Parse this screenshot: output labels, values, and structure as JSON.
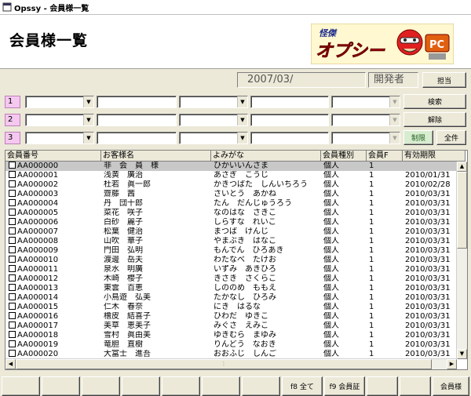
{
  "window": {
    "title": "Opssy - 会員様一覧"
  },
  "header": {
    "title": "会員様一覧",
    "logo_text": "オプシー",
    "logo_sub": "怪傑",
    "logo_badge": "PC"
  },
  "info": {
    "date": "2007/03/",
    "user": "開発者",
    "charge_button": "担当"
  },
  "filters": {
    "rows": [
      {
        "num": "1",
        "action": "検索"
      },
      {
        "num": "2",
        "action": "解除"
      },
      {
        "num": "3",
        "action": "制限",
        "action2": "全件"
      }
    ]
  },
  "table": {
    "columns": [
      "会員番号",
      "お客様名",
      "よみがな",
      "会員種別",
      "会員F",
      "有効期限"
    ],
    "rows": [
      [
        "AA000000",
        "非　会　員　様",
        "ひかいいんさま",
        "個人",
        "1",
        ""
      ],
      [
        "AA000001",
        "浅黄　廣治",
        "あさぎ　こうじ",
        "個人",
        "1",
        "2010/01/31"
      ],
      [
        "AA000002",
        "杜若　眞一郎",
        "かきつばた　しんいちろう",
        "個人",
        "1",
        "2010/02/28"
      ],
      [
        "AA000003",
        "齋藤　茜",
        "さいとう　あかね",
        "個人",
        "1",
        "2010/03/31"
      ],
      [
        "AA000004",
        "丹　団十郎",
        "たん　だんじゅうろう",
        "個人",
        "1",
        "2010/03/31"
      ],
      [
        "AA000005",
        "菜花　咲子",
        "なのはな　さきこ",
        "個人",
        "1",
        "2010/03/31"
      ],
      [
        "AA000006",
        "白砂　麗子",
        "しらすな　れいこ",
        "個人",
        "1",
        "2010/03/31"
      ],
      [
        "AA000007",
        "松葉　健治",
        "まつば　けんじ",
        "個人",
        "1",
        "2010/03/31"
      ],
      [
        "AA000008",
        "山吹　華子",
        "やまぶき　はなこ",
        "個人",
        "1",
        "2010/03/31"
      ],
      [
        "AA000009",
        "門田　弘明",
        "もんでん　ひろあき",
        "個人",
        "1",
        "2010/03/31"
      ],
      [
        "AA000010",
        "渡邊　岳夫",
        "わたなべ　たけお",
        "個人",
        "1",
        "2010/03/31"
      ],
      [
        "AA000011",
        "泉水　明廣",
        "いずみ　あきひろ",
        "個人",
        "1",
        "2010/03/31"
      ],
      [
        "AA000012",
        "木崎　櫻子",
        "きさき　さくらこ",
        "個人",
        "1",
        "2010/03/31"
      ],
      [
        "AA000013",
        "東雲　百恵",
        "しののめ　ももえ",
        "個人",
        "1",
        "2010/03/31"
      ],
      [
        "AA000014",
        "小鳥遊　弘美",
        "たかなし　ひろみ",
        "個人",
        "1",
        "2010/03/31"
      ],
      [
        "AA000015",
        "仁木　春奈",
        "にき　はるな",
        "個人",
        "1",
        "2010/03/31"
      ],
      [
        "AA000016",
        "檜皮　結喜子",
        "ひわだ　ゆきこ",
        "個人",
        "1",
        "2010/03/31"
      ],
      [
        "AA000017",
        "美草　恵美子",
        "みぐさ　えみこ",
        "個人",
        "1",
        "2010/03/31"
      ],
      [
        "AA000018",
        "雪村　眞由美",
        "ゆきむら　まゆみ",
        "個人",
        "1",
        "2010/03/31"
      ],
      [
        "AA000019",
        "竜胆　直樹",
        "りんどう　なおき",
        "個人",
        "1",
        "2010/03/31"
      ],
      [
        "AA000020",
        "大富士　進吾",
        "おおふじ　しんご",
        "個人",
        "1",
        "2010/03/31"
      ]
    ]
  },
  "footer": {
    "f8": "f8 全て",
    "f9": "f9 会員証",
    "members": "会員様"
  }
}
